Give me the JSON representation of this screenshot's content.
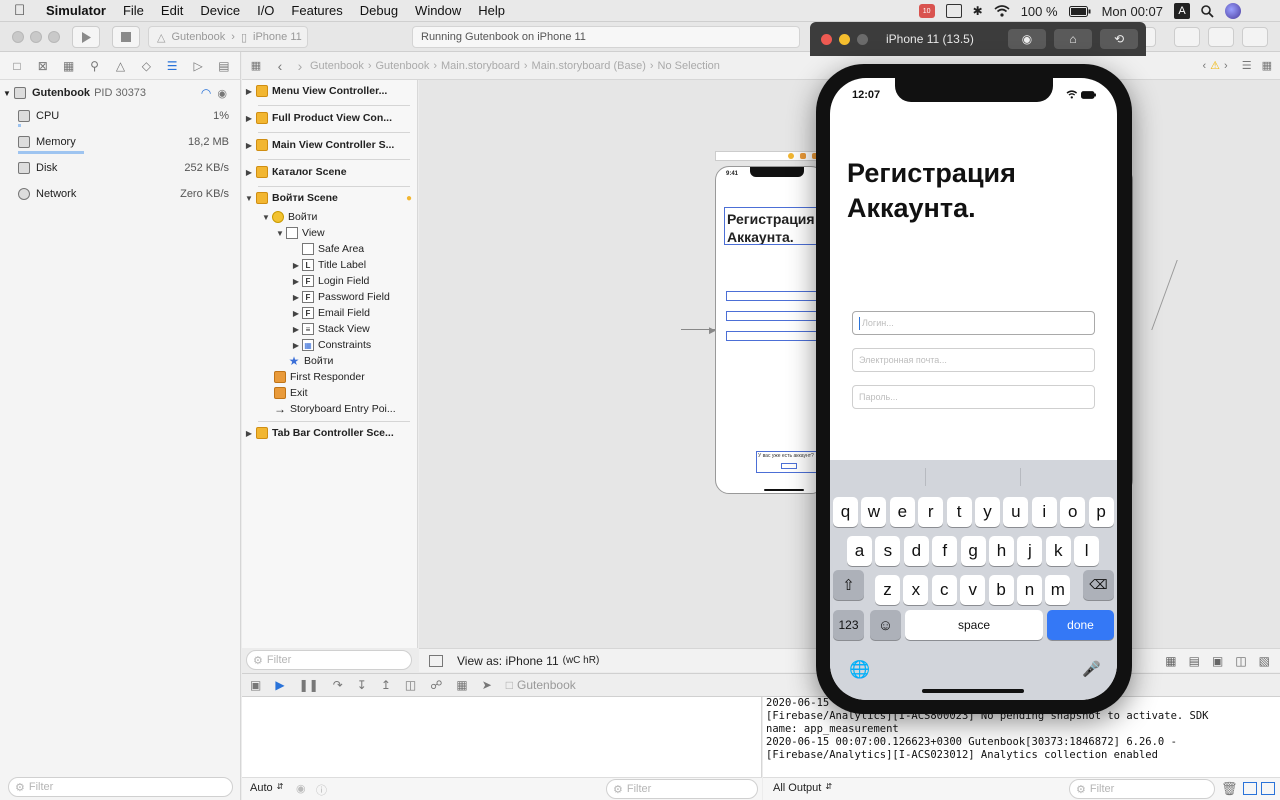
{
  "menubar": {
    "apple_icon": "apple-logo",
    "items": [
      "Simulator",
      "File",
      "Edit",
      "Device",
      "I/O",
      "Features",
      "Debug",
      "Window",
      "Help"
    ],
    "right": {
      "badge": "10",
      "battery": "100 %",
      "clock": "Mon 00:07",
      "input_source": "A"
    }
  },
  "toolbar": {
    "scheme_project": "Gutenbook",
    "scheme_device": "iPhone 11",
    "status": "Running Gutenbook on iPhone 11"
  },
  "navigator": {
    "process": {
      "name": "Gutenbook",
      "pid": "PID 30373"
    },
    "gauges": [
      {
        "label": "CPU",
        "value": "1%"
      },
      {
        "label": "Memory",
        "value": "18,2 MB"
      },
      {
        "label": "Disk",
        "value": "252 KB/s"
      },
      {
        "label": "Network",
        "value": "Zero KB/s"
      }
    ],
    "filter_placeholder": "Filter"
  },
  "jumpbar": {
    "crumbs": [
      "Gutenbook",
      "Gutenbook",
      "Main.storyboard",
      "Main.storyboard (Base)",
      "No Selection"
    ]
  },
  "outline": {
    "scenes_top": [
      "Menu View Controller...",
      "Full Product View Con...",
      "Main View Controller S...",
      "Каталог Scene",
      "Войти Scene"
    ],
    "tree": [
      "Войти",
      "View",
      "Safe Area",
      "Title Label",
      "Login Field",
      "Password Field",
      "Email Field",
      "Stack View",
      "Constraints",
      "Войти",
      "First Responder",
      "Exit",
      "Storyboard Entry Poi..."
    ],
    "scene_last": "Tab Bar Controller Sce...",
    "filter_placeholder": "Filter"
  },
  "canvas": {
    "view_as": "View as: iPhone 11",
    "size_class": "(wC hR)",
    "mini_time": "9:41",
    "mini_title": "Регистрация Аккаунта.",
    "mini_footer": "У вас уже есть аккаунт?"
  },
  "debug": {
    "process": "Gutenbook",
    "auto_label": "Auto",
    "filter_placeholder": "Filter",
    "all_output": "All Output",
    "console_lines": [
      "2020-06-15 00:07:00.124...                72] 6.26.0 -",
      "    [Firebase/Analytics][I-ACS800023] No pending snapshot to activate. SDK",
      "    name: app_measurement",
      "2020-06-15 00:07:00.126623+0300 Gutenbook[30373:1846872] 6.26.0 -",
      "    [Firebase/Analytics][I-ACS023012] Analytics collection enabled"
    ]
  },
  "simulator": {
    "window_title": "iPhone 11 (13.5)",
    "status_time": "12:07",
    "screen_title": "Регистрация Аккаунта.",
    "fields": [
      {
        "placeholder": "Логин..."
      },
      {
        "placeholder": "Электронная почта..."
      },
      {
        "placeholder": "Пароль..."
      }
    ],
    "keyboard": {
      "row1": [
        "q",
        "w",
        "e",
        "r",
        "t",
        "y",
        "u",
        "i",
        "o",
        "p"
      ],
      "row2": [
        "a",
        "s",
        "d",
        "f",
        "g",
        "h",
        "j",
        "k",
        "l"
      ],
      "row3": [
        "z",
        "x",
        "c",
        "v",
        "b",
        "n",
        "m"
      ],
      "numbers_key": "123",
      "space_key": "space",
      "done_key": "done"
    }
  },
  "colors": {
    "accent": "#2a73d9",
    "done_key": "#3478f6",
    "keyboard_bg": "#d2d5db",
    "scene_icon": "#f2b631"
  }
}
